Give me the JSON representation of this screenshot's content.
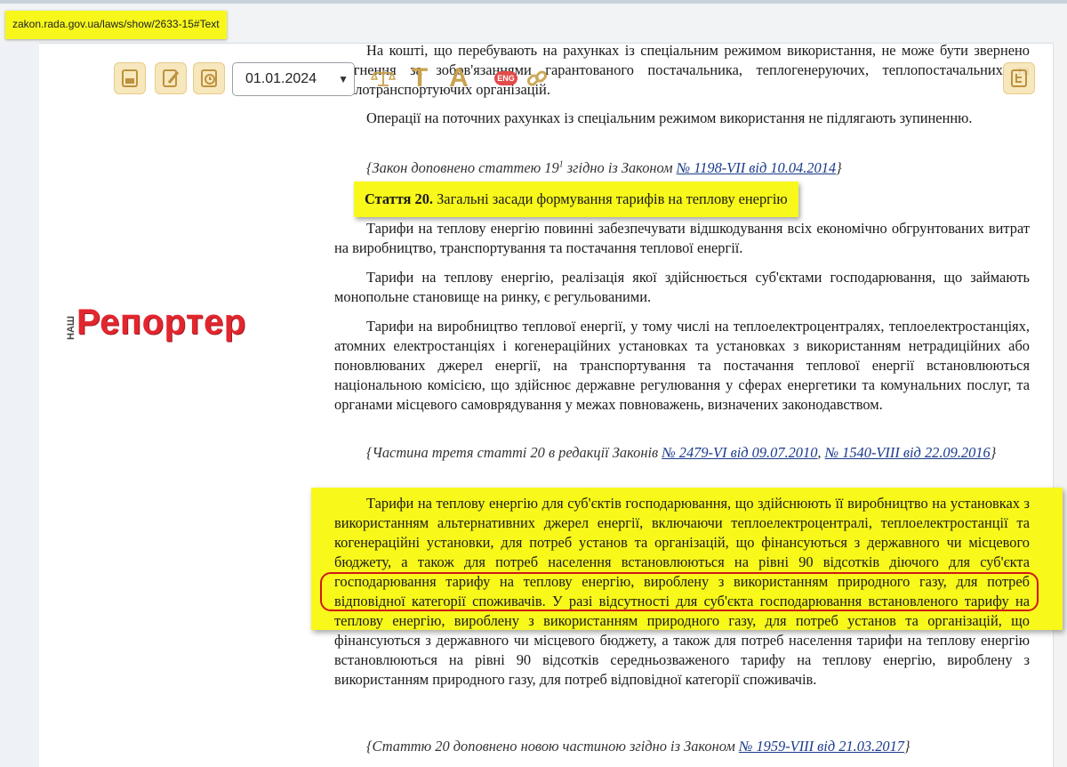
{
  "browser": {
    "url": "zakon.rada.gov.ua/laws/show/2633-15#Text"
  },
  "toolbar": {
    "date_value": "01.01.2024",
    "letter_t": "T",
    "letter_a": "A",
    "eng_badge": "ENG"
  },
  "logo": {
    "prefix": "НАШ",
    "word": "Репортер"
  },
  "document": {
    "p1": "На коштi, що перебувають на рахунках iз спецiальним режимом використання, не може бути звернено стягнення за зобов'язаннями гарантованого постачальника, теплогенеруючих, теплопостачальних та теплотранспортуючих органiзацiй.",
    "p2": "Операцiї на поточних рахунках iз спецiальним режимом використання не пiдлягають зупиненню.",
    "note1_prefix": "{Закон доповнено статтею 19",
    "note1_sup": "1",
    "note1_mid": " згiдно iз Законом ",
    "note1_link": "№ 1198-VII вiд 10.04.2014",
    "note1_suffix": "}",
    "heading_bold": "Стаття 20.",
    "heading_text": " Загальнi засади формування тарифiв на теплову енергiю",
    "p3": "Тарифи на теплову енергiю повиннi забезпечувати вiдшкодування всiх економiчно обгрунтованих витрат на виробництво, транспортування та постачання теплової енергiї.",
    "p4": "Тарифи на теплову енергiю, реалiзацiя якої здiйснюється суб'єктами господарювання, що займають монопольне становище на ринку, є регульованими.",
    "p5": "Тарифи на виробництво теплової енергiї, у тому числi на теплоелектроцентралях, теплоелектростанцiях, атомних електростанцiях i когенерацiйних установках та установках з використанням нетрадицiйних або поновлюваних джерел енергiї, на транспортування та постачання теплової енергiї встановлюються нацiональною комiсiєю, що здiйснює державне регулювання у сферах енергетики та комунальних послуг, та органами мiсцевого самоврядування у межах повноважень, визначених законодавством.",
    "note2_prefix": "{Частина третя статтi 20 в редакцiї Законiв ",
    "note2_link1": "№ 2479-VI вiд 09.07.2010",
    "note2_sep": ", ",
    "note2_link2": "№ 1540-VIII вiд 22.09.2016",
    "note2_suffix": "}",
    "p6_main": "Тарифи на теплову енергiю для суб'єктiв господарювання, що здiйснюють її виробництво на установках з використанням альтернативних джерел енергiї, включаючи теплоелектроцентралi, теплоелектростанцiї та когенерацiйнi установки, для потреб установ та органiзацiй, що фiнансуються з державного чи мiсцевого бюджету, а також для потреб населення встановлюються на рiвнi 90 вiдсоткiв дiючого для суб'єкта господарювання тарифу на теплову енергiю, вироблену з використанням природного газу, для потреб вiдповiдної категорiї споживачiв.",
    "p6_rest": " У разi вiдсутностi для суб'єкта господарювання встановленого тарифу на теплову енергiю, вироблену з використанням природного газу, для потреб установ та органiзацiй, що фiнансуються з державного чи мiсцевого бюджету, а також для потреб населення тарифи на теплову енергiю встановлюються на рiвнi 90 вiдсоткiв середньозваженого тарифу на теплову енергiю, вироблену з використанням природного газу, для потреб вiдповiдної категорiї споживачiв.",
    "note3_prefix": "{Статтю 20 доповнено новою частиною згiдно iз Законом ",
    "note3_link": "№ 1959-VIII вiд 21.03.2017",
    "note3_suffix": "}"
  },
  "colors": {
    "highlight": "#f8f81a",
    "circle": "#d01818",
    "link": "#1a3a8a",
    "logo": "#e3262e"
  }
}
